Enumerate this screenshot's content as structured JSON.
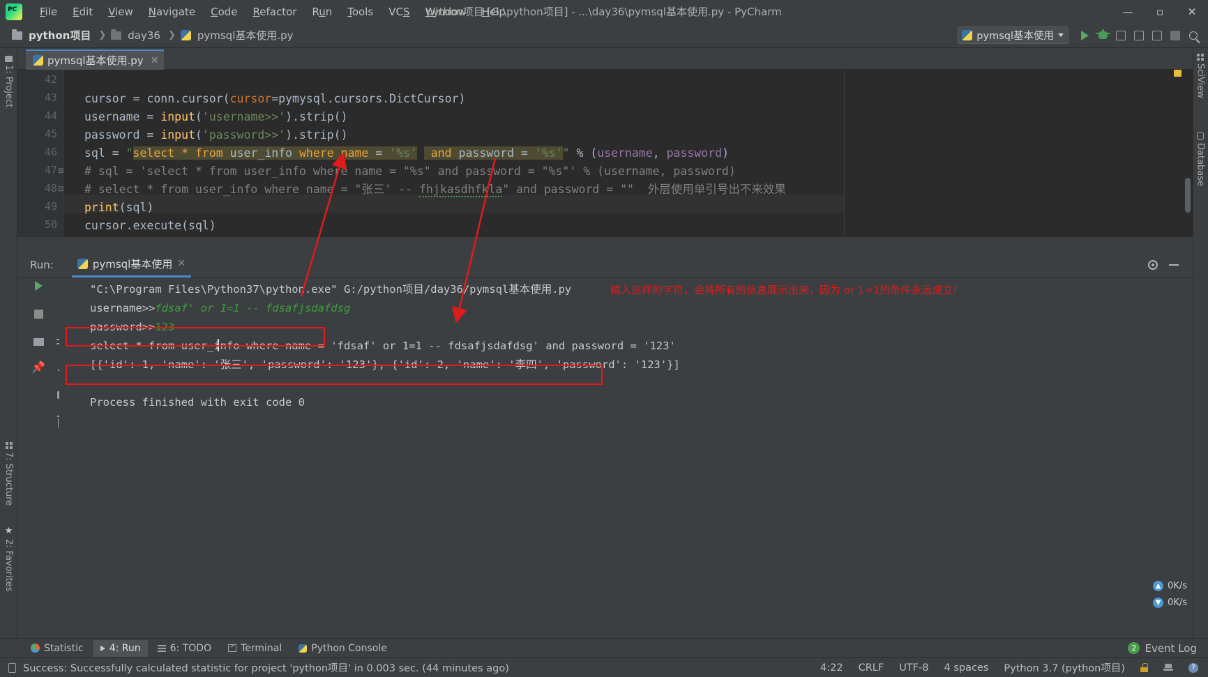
{
  "window": {
    "title": "python项目 [G:\\python项目] - ...\\day36\\pymsql基本使用.py - PyCharm",
    "minimize": "—",
    "maximize": "▫",
    "close": "✕"
  },
  "menu": [
    "File",
    "Edit",
    "View",
    "Navigate",
    "Code",
    "Refactor",
    "Run",
    "Tools",
    "VCS",
    "Window",
    "Help"
  ],
  "breadcrumb": [
    {
      "label": "python项目",
      "icon": "folder-icon"
    },
    {
      "label": "day36",
      "icon": "folder-icon"
    },
    {
      "label": "pymsql基本使用.py",
      "icon": "python-file-icon"
    }
  ],
  "breadcrumb_sep": "❯",
  "run_config": {
    "name": "pymsql基本使用",
    "icon": "python-file-icon",
    "caret": "▾"
  },
  "left_strip": [
    {
      "label": "1: Project",
      "icon": "project-folder-icon"
    },
    {
      "label": "7: Structure",
      "icon": "structure-grid-icon"
    },
    {
      "label": "2: Favorites",
      "icon": "star-icon"
    }
  ],
  "right_strip": [
    {
      "label": "SciView",
      "icon": "sciview-grid-icon"
    },
    {
      "label": "Database",
      "icon": "database-icon"
    }
  ],
  "editor_tab": {
    "label": "pymsql基本使用.py",
    "close": "✕",
    "icon": "python-file-icon"
  },
  "editor": {
    "lines": [
      {
        "num": "42",
        "text": ""
      },
      {
        "num": "43",
        "text": "cursor = conn.cursor(cursor=pymysql.cursors.DictCursor)"
      },
      {
        "num": "44",
        "text": "username = input('username>>').strip()"
      },
      {
        "num": "45",
        "text": "password = input('password>>').strip()"
      },
      {
        "num": "46",
        "text": "sql = \"select * from user_info where name = '%s' and password = '%s'\" % (username, password)"
      },
      {
        "num": "47",
        "text": "# sql = 'select * from user_info where name = \"%s\" and password = \"%s\"' % (username, password)"
      },
      {
        "num": "48",
        "text": "# select * from user_info where name = \"张三' -- fhjkasdhfkla\" and password = \"\"  外层使用单引号出不来效果"
      },
      {
        "num": "49",
        "text": "print(sql)"
      },
      {
        "num": "50",
        "text": "cursor.execute(sql)"
      }
    ],
    "line48_comment_cn": "外层使用单引号出不来效果"
  },
  "run_panel": {
    "label": "Run:",
    "tab": {
      "label": "pymsql基本使用",
      "close": "✕",
      "icon": "python-file-icon"
    },
    "settings_icon": "gear-icon",
    "minimize_icon": "minimize-icon",
    "side_buttons": [
      "rerun-icon",
      "up-arrow-icon",
      "stop-icon",
      "down-arrow-icon",
      "soft-wrap-icon",
      "scroll-to-end-icon",
      "print-icon",
      "pin-icon",
      "clear-all-icon"
    ],
    "console_lines": [
      "\"C:\\Program Files\\Python37\\python.exe\" G:/python项目/day36/pymsql基本使用.py",
      "username>>fdsaf' or 1=1 -- fdsafjsdafdsg",
      "password>>123",
      "select * from user_info where name = 'fdsaf' or 1=1 -- fdsafjsdafdsg' and password = '123'",
      "[{'id': 1, 'name': '张三', 'password': '123'}, {'id': 2, 'name': '李四', 'password': '123'}]",
      "",
      "Process finished with exit code 0"
    ],
    "console_prompt_username": "username>>",
    "console_input_username": "fdsaf' or 1=1 -- fdsafjsdafdsg",
    "console_prompt_password": "password>>",
    "console_input_password": "123",
    "annotation": "输入这样的字符，会将所有的信息展示出来，因为 or 1=1的条件永远成立!",
    "annotation_color": "#e01b1b"
  },
  "network": [
    {
      "value": "0K/s"
    },
    {
      "value": "0K/s"
    }
  ],
  "bottom_bar": {
    "items": [
      {
        "label": "Statistic",
        "icon": "statistic-icon",
        "active": false
      },
      {
        "label": "4: Run",
        "icon": "run-triangle-icon",
        "active": true
      },
      {
        "label": "6: TODO",
        "icon": "todo-icon",
        "active": false
      },
      {
        "label": "Terminal",
        "icon": "terminal-icon",
        "active": false
      },
      {
        "label": "Python Console",
        "icon": "python-console-icon",
        "active": false
      }
    ],
    "event_log": {
      "label": "Event Log",
      "count": "2"
    }
  },
  "status_bar": {
    "message": "Success: Successfully calculated statistic for project 'python项目' in 0.003 sec. (44 minutes ago)",
    "caret_position": "4:22",
    "line_separator": "CRLF",
    "encoding": "UTF-8",
    "indent": "4 spaces",
    "interpreter": "Python 3.7 (python项目)",
    "icons": [
      "lock-icon",
      "inspection-hat-icon",
      "settings-badge-icon"
    ]
  },
  "colors": {
    "accent_blue": "#4a88c7",
    "run_green": "#59a869",
    "annotation_red": "#e01b1b",
    "editor_bg": "#2b2b2b",
    "panel_bg": "#3c3f41"
  }
}
